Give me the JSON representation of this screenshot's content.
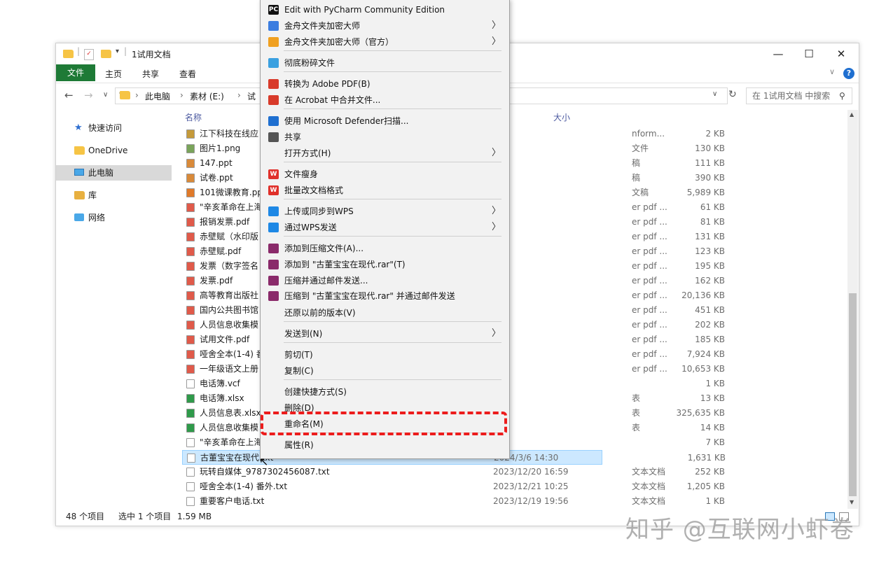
{
  "window": {
    "title": "1试用文档",
    "controls": {
      "minimize": "—",
      "maximize": "☐",
      "close": "✕"
    }
  },
  "ribbon": {
    "file": "文件",
    "tabs": [
      "主页",
      "共享",
      "查看"
    ],
    "help": "?"
  },
  "address": {
    "crumbs": [
      "此电脑",
      "素材 (E:)",
      "试"
    ],
    "search_placeholder": "在 1试用文档 中搜索"
  },
  "nav": {
    "items": [
      "快速访问",
      "OneDrive",
      "此电脑",
      "库",
      "网络"
    ]
  },
  "list": {
    "col_name": "名称",
    "col_size": "大小",
    "rows": [
      {
        "name": "江下科技在线应",
        "type": "nform...",
        "date": "",
        "size": "2 KB",
        "color": "#c59a3a"
      },
      {
        "name": "图片1.png",
        "type": "文件",
        "date": "",
        "size": "130 KB",
        "color": "#7aa45a"
      },
      {
        "name": "147.ppt",
        "type": "稿",
        "date": "",
        "size": "111 KB",
        "color": "#d98a3a"
      },
      {
        "name": "试卷.ppt",
        "type": "稿",
        "date": "",
        "size": "390 KB",
        "color": "#d98a3a"
      },
      {
        "name": "101微课教育.pp",
        "type": "文稿",
        "date": "",
        "size": "5,989 KB",
        "color": "#e07a2a"
      },
      {
        "name": "\"辛亥革命在上海",
        "type": "er pdf ...",
        "date": "",
        "size": "61 KB",
        "color": "#e05a4a"
      },
      {
        "name": "报销发票.pdf",
        "type": "er pdf ...",
        "date": "",
        "size": "81 KB",
        "color": "#e05a4a"
      },
      {
        "name": "赤壁赋（水印版",
        "type": "er pdf ...",
        "date": "",
        "size": "131 KB",
        "color": "#e05a4a"
      },
      {
        "name": "赤壁赋.pdf",
        "type": "er pdf ...",
        "date": "",
        "size": "123 KB",
        "color": "#e05a4a"
      },
      {
        "name": "发票（数字签名",
        "type": "er pdf ...",
        "date": "",
        "size": "195 KB",
        "color": "#e05a4a"
      },
      {
        "name": "发票.pdf",
        "type": "er pdf ...",
        "date": "",
        "size": "162 KB",
        "color": "#e05a4a"
      },
      {
        "name": "高等教育出版社",
        "type": "er pdf ...",
        "date": "",
        "size": "20,136 KB",
        "color": "#e05a4a"
      },
      {
        "name": "国内公共图书馆",
        "type": "er pdf ...",
        "date": "",
        "size": "451 KB",
        "color": "#e05a4a"
      },
      {
        "name": "人员信息收集模",
        "type": "er pdf ...",
        "date": "",
        "size": "202 KB",
        "color": "#e05a4a"
      },
      {
        "name": "试用文件.pdf",
        "type": "er pdf ...",
        "date": "",
        "size": "185 KB",
        "color": "#e05a4a"
      },
      {
        "name": "哑舍全本(1-4) 番",
        "type": "er pdf ...",
        "date": "",
        "size": "7,924 KB",
        "color": "#e05a4a"
      },
      {
        "name": "一年级语文上册",
        "type": "er pdf ...",
        "date": "",
        "size": "10,653 KB",
        "color": "#e05a4a"
      },
      {
        "name": "电话簿.vcf",
        "type": "",
        "date": "",
        "size": "1 KB",
        "color": "#ffffff"
      },
      {
        "name": "电话簿.xlsx",
        "type": "表",
        "date": "",
        "size": "13 KB",
        "color": "#2f9a4a"
      },
      {
        "name": "人员信息表.xlsx",
        "type": "表",
        "date": "",
        "size": "325,635 KB",
        "color": "#2f9a4a"
      },
      {
        "name": "人员信息收集模",
        "type": "表",
        "date": "",
        "size": "14 KB",
        "color": "#2f9a4a"
      },
      {
        "name": "\"辛亥革命在上海",
        "type": "",
        "date": "",
        "size": "7 KB",
        "color": "#ffffff"
      },
      {
        "name": "古董宝宝在现代.txt",
        "type": "",
        "date": "2024/3/6 14:30",
        "size": "1,631 KB",
        "color": "#ffffff",
        "selected": true
      },
      {
        "name": "玩转自媒体_9787302456087.txt",
        "type": "文本文档",
        "date": "2023/12/20 16:59",
        "size": "252 KB",
        "color": "#ffffff"
      },
      {
        "name": "哑舍全本(1-4) 番外.txt",
        "type": "文本文档",
        "date": "2023/12/21 10:25",
        "size": "1,205 KB",
        "color": "#ffffff"
      },
      {
        "name": "重要客户电话.txt",
        "type": "文本文档",
        "date": "2023/12/19 19:56",
        "size": "1 KB",
        "color": "#ffffff"
      }
    ]
  },
  "status": {
    "count": "48 个项目",
    "selected": "选中 1 个项目",
    "size": "1.59 MB"
  },
  "menu": {
    "items": [
      {
        "label": "Edit with PyCharm Community Edition",
        "icon": "pycharm-icon",
        "icon_text": "PC",
        "color": "#111111",
        "arrow": false
      },
      {
        "label": "金舟文件夹加密大师",
        "icon": "lock-folder-icon",
        "icon_text": "",
        "color": "#3b7de0",
        "arrow": true
      },
      {
        "label": "金舟文件夹加密大师（官方）",
        "icon": "lock-folder-icon",
        "icon_text": "",
        "color": "#f0a020",
        "arrow": true
      },
      {
        "label": "彻底粉碎文件",
        "icon": "shredder-icon",
        "icon_text": "",
        "color": "#3aa0e0",
        "arrow": false,
        "sep_before": true
      },
      {
        "label": "转换为 Adobe PDF(B)",
        "icon": "adobe-pdf-icon",
        "icon_text": "",
        "color": "#d83a2a",
        "arrow": false,
        "sep_before": true
      },
      {
        "label": "在 Acrobat 中合并文件...",
        "icon": "acrobat-merge-icon",
        "icon_text": "",
        "color": "#d83a2a",
        "arrow": false
      },
      {
        "label": "使用 Microsoft Defender扫描...",
        "icon": "defender-shield-icon",
        "icon_text": "",
        "color": "#1f6fd0",
        "arrow": false,
        "sep_before": true
      },
      {
        "label": "共享",
        "icon": "share-icon",
        "icon_text": "",
        "color": "#555555",
        "arrow": false
      },
      {
        "label": "打开方式(H)",
        "icon": "",
        "icon_text": "",
        "color": "",
        "arrow": true
      },
      {
        "label": "文件瘦身",
        "icon": "wps-icon",
        "icon_text": "W",
        "color": "#e0302a",
        "arrow": false,
        "sep_before": true
      },
      {
        "label": "批量改文档格式",
        "icon": "wps-icon",
        "icon_text": "W",
        "color": "#e0302a",
        "arrow": false
      },
      {
        "label": "上传或同步到WPS",
        "icon": "cloud-icon",
        "icon_text": "",
        "color": "#1e88e5",
        "arrow": true,
        "sep_before": true
      },
      {
        "label": "通过WPS发送",
        "icon": "send-icon",
        "icon_text": "",
        "color": "#1e88e5",
        "arrow": true
      },
      {
        "label": "添加到压缩文件(A)...",
        "icon": "winrar-icon",
        "icon_text": "",
        "color": "#8a2a6a",
        "arrow": false,
        "sep_before": true
      },
      {
        "label": "添加到 \"古董宝宝在现代.rar\"(T)",
        "icon": "winrar-icon",
        "icon_text": "",
        "color": "#8a2a6a",
        "arrow": false
      },
      {
        "label": "压缩并通过邮件发送...",
        "icon": "winrar-icon",
        "icon_text": "",
        "color": "#8a2a6a",
        "arrow": false
      },
      {
        "label": "压缩到 \"古董宝宝在现代.rar\" 并通过邮件发送",
        "icon": "winrar-icon",
        "icon_text": "",
        "color": "#8a2a6a",
        "arrow": false
      },
      {
        "label": "还原以前的版本(V)",
        "icon": "",
        "icon_text": "",
        "color": "",
        "arrow": false
      },
      {
        "label": "发送到(N)",
        "icon": "",
        "icon_text": "",
        "color": "",
        "arrow": true,
        "sep_before": true
      },
      {
        "label": "剪切(T)",
        "icon": "",
        "icon_text": "",
        "color": "",
        "arrow": false,
        "sep_before": true
      },
      {
        "label": "复制(C)",
        "icon": "",
        "icon_text": "",
        "color": "",
        "arrow": false
      },
      {
        "label": "创建快捷方式(S)",
        "icon": "",
        "icon_text": "",
        "color": "",
        "arrow": false,
        "sep_before": true
      },
      {
        "label": "删除(D)",
        "icon": "",
        "icon_text": "",
        "color": "",
        "arrow": false
      },
      {
        "label": "重命名(M)",
        "icon": "",
        "icon_text": "",
        "color": "",
        "arrow": false
      },
      {
        "label": "属性(R)",
        "icon": "",
        "icon_text": "",
        "color": "",
        "arrow": false,
        "sep_before": true
      }
    ]
  },
  "watermark": "知乎 @互联网小虾卷"
}
